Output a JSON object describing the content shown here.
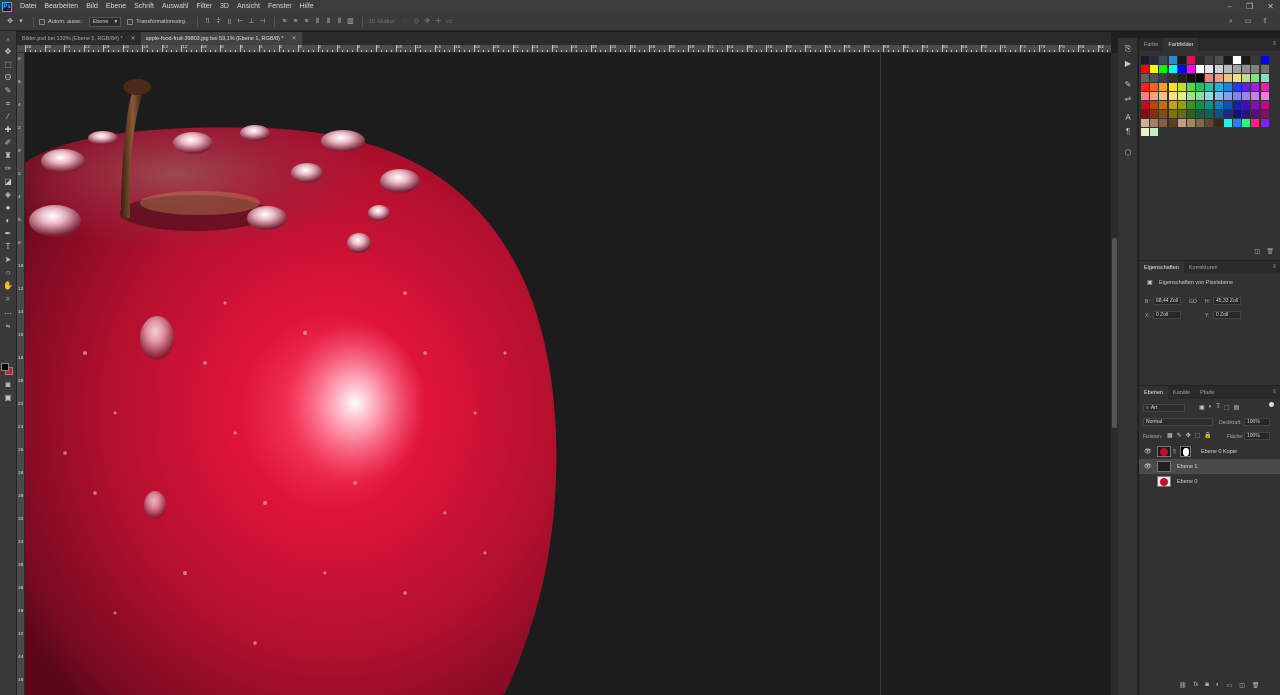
{
  "menu": {
    "logo": "Ps",
    "items": [
      "Datei",
      "Bearbeiten",
      "Bild",
      "Ebene",
      "Schrift",
      "Auswahl",
      "Filter",
      "3D",
      "Ansicht",
      "Fenster",
      "Hilfe"
    ],
    "window_controls": [
      "–",
      "❐",
      "✕"
    ]
  },
  "options": {
    "auto_select_label": "Autom. ausw.:",
    "auto_select_value": "Ebene",
    "transform_label": "Transformationsstrg.",
    "mode_3d_label": "3D-Modus:"
  },
  "tabs": [
    {
      "label": "Bilder.psd bei 133% (Ebene 5, RGB/8#) *",
      "active": false,
      "close": "✕"
    },
    {
      "label": "apple-food-fruit-39803.jpg bei 59,1% (Ebene 1, RGB/8) *",
      "active": true,
      "close": "✕"
    }
  ],
  "ruler": {
    "h_labels": [
      "28",
      "26",
      "24",
      "22",
      "20",
      "18",
      "16",
      "14",
      "12",
      "10",
      "8",
      "6",
      "4",
      "2",
      "0",
      "2",
      "4",
      "6",
      "8",
      "10",
      "12",
      "14",
      "16",
      "18",
      "20",
      "22",
      "24",
      "26",
      "28",
      "30",
      "32",
      "34",
      "36",
      "38",
      "40",
      "42",
      "44",
      "46",
      "48",
      "50",
      "52",
      "54",
      "56",
      "58",
      "60",
      "62",
      "64",
      "66",
      "68",
      "70",
      "72",
      "74",
      "76",
      "78",
      "80",
      "82",
      "84"
    ],
    "v_labels": [
      "8",
      "6",
      "4",
      "2",
      "0",
      "2",
      "4",
      "6",
      "8",
      "10",
      "12",
      "14",
      "16",
      "18",
      "20",
      "22",
      "24",
      "26",
      "28",
      "30",
      "32",
      "34",
      "36",
      "38",
      "40",
      "42",
      "44",
      "46"
    ]
  },
  "panels": {
    "color": {
      "tabs": [
        "Farbe",
        "Farbfelder"
      ],
      "active_tab": "Farbfelder",
      "menu_icon": "≡"
    },
    "properties": {
      "tabs": [
        "Eigenschaften",
        "Korrekturen"
      ],
      "active_tab": "Eigenschaften",
      "title": "Eigenschaften von Pixelebene",
      "b_label": "B:",
      "b_value": "68,44 Zoll",
      "link_icon": "GO",
      "h_label": "H:",
      "h_value": "45,33 Zoll",
      "x_label": "X:",
      "x_value": "0 Zoll",
      "y_label": "Y:",
      "y_value": "0 Zoll"
    },
    "layers": {
      "tabs": [
        "Ebenen",
        "Kanäle",
        "Pfade"
      ],
      "active_tab": "Ebenen",
      "filter_label": "Art",
      "blend_mode": "Normal",
      "opacity_label": "Deckkraft:",
      "opacity_value": "100%",
      "lock_label": "Fixieren:",
      "fill_label": "Fläche:",
      "fill_value": "100%",
      "items": [
        {
          "name": "Ebene 0 Kopie",
          "visible": true,
          "selected": false
        },
        {
          "name": "Ebene 1",
          "visible": true,
          "selected": true
        },
        {
          "name": "Ebene 0",
          "visible": false,
          "selected": false
        }
      ]
    }
  },
  "colors": {
    "accent": "#31a8ff",
    "foreground": "#000000",
    "background": "#e0102e",
    "apple_red": "#c0102a"
  }
}
